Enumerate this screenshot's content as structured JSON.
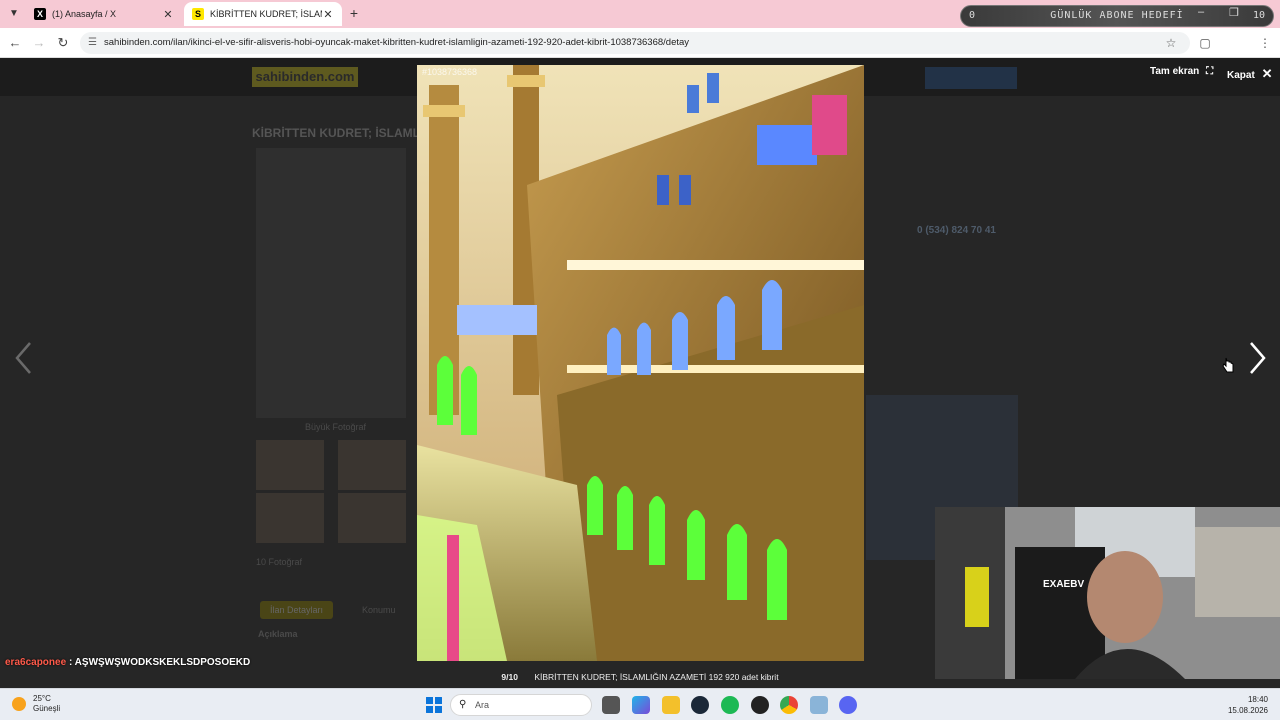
{
  "browser": {
    "tabs": [
      {
        "title": "(1) Anasayfa / X",
        "favicon": "x-logo"
      },
      {
        "title": "KİBRİTTEN KUDRET; İSLAMLIĞIN",
        "favicon": "sahibinden-logo"
      }
    ],
    "url": "sahibinden.com/ilan/ikinci-el-ve-sifir-alisveris-hobi-oyuncak-maket-kibritten-kudret-islamligin-azameti-192-920-adet-kibrit-1038736368/detay",
    "subscriber_goal": {
      "current": "0",
      "label": "GÜNLÜK ABONE HEDEFİ",
      "target": "10"
    }
  },
  "background_page": {
    "logo": "sahibinden.com",
    "listing_title": "KİBRİTTEN KUDRET; İSLAMLI",
    "enlarge_photo": "Büyük Fotoğraf",
    "photo_count": "10 Fotoğraf",
    "phone": "0 (534) 824 70 41",
    "tabs": [
      "İlan Detayları",
      "Konumu"
    ],
    "description_label": "Açıklama"
  },
  "lightbox": {
    "listing_number": "#1038736368",
    "fullscreen_label": "Tam ekran",
    "close_label": "Kapat",
    "counter": "9/10",
    "caption": "KİBRİTTEN KUDRET; İSLAMLIĞIN AZAMETİ 192 920 adet kibrit"
  },
  "stream": {
    "chat_user": "era6caponee",
    "chat_message": ": AŞWŞWŞWODKSKEKLSDPOSOEKD",
    "shirt_text": "EXAEBV"
  },
  "taskbar": {
    "temperature": "25°C",
    "weather_condition": "Güneşli",
    "search_placeholder": "Ara",
    "time": "18:40",
    "date": "15.08.2026"
  },
  "colors": {
    "tab_strip": "#f6c9d4",
    "sahibinden_yellow": "#ffe800",
    "chat_username": "#ff5a4a"
  }
}
